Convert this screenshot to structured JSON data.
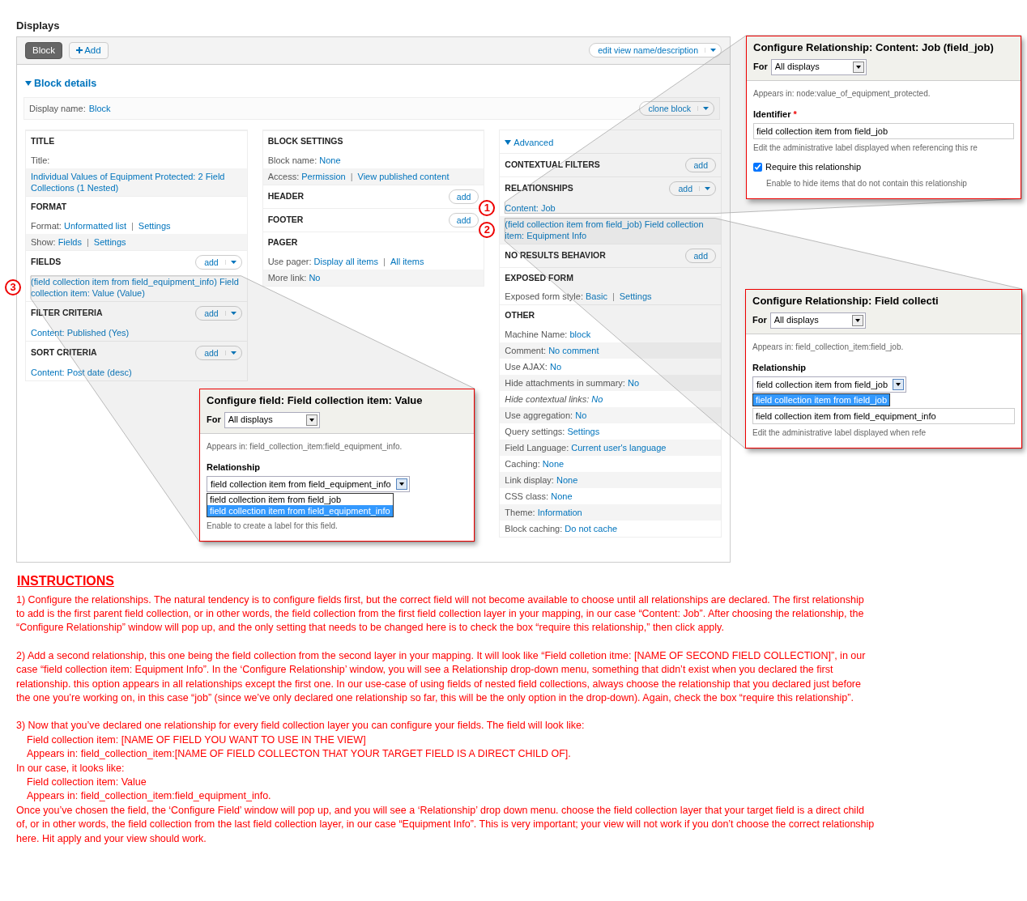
{
  "heading": "Displays",
  "display_tabs": [
    {
      "label": "Block",
      "kind": "display",
      "selected": true
    },
    {
      "label": "Add",
      "kind": "add",
      "selected": false
    }
  ],
  "edit_button": {
    "label": "edit view name/description",
    "dropdown": true
  },
  "details": {
    "label": "Block details",
    "expanded": true
  },
  "display_name": {
    "label": "Display name:",
    "value": "Block"
  },
  "clone_button": {
    "label": "clone block",
    "dropdown": true
  },
  "columns": [
    {
      "sections": [
        {
          "title": "TITLE",
          "rows": [
            {
              "label": "Title:"
            },
            {
              "values": [
                "Individual Values of Equipment Protected: 2 Field Collections (1 Nested)"
              ]
            }
          ]
        },
        {
          "title": "FORMAT",
          "rows": [
            {
              "label": "Format:",
              "values": [
                "Unformatted list",
                "|",
                "Settings"
              ]
            },
            {
              "label": "Show:",
              "values": [
                "Fields",
                "|",
                "Settings"
              ]
            }
          ]
        },
        {
          "title": "FIELDS",
          "add": {
            "label": "add",
            "dropdown": true
          },
          "rows": [
            {
              "values": [
                "(field collection item from field_equipment_info) Field collection item: Value (Value)"
              ],
              "marker": "3"
            }
          ]
        },
        {
          "title": "FILTER CRITERIA",
          "add": {
            "label": "add",
            "dropdown": true
          },
          "rows": [
            {
              "values": [
                "Content: Published (Yes)"
              ]
            }
          ]
        },
        {
          "title": "SORT CRITERIA",
          "add": {
            "label": "add",
            "dropdown": true
          },
          "rows": [
            {
              "values": [
                "Content: Post date (desc)"
              ]
            }
          ]
        }
      ]
    },
    {
      "sections": [
        {
          "title": "BLOCK SETTINGS",
          "rows": [
            {
              "label": "Block name:",
              "values": [
                "None"
              ]
            },
            {
              "label": "Access:",
              "values": [
                "Permission",
                "|",
                "View published content"
              ]
            }
          ]
        },
        {
          "title": "HEADER",
          "add": {
            "label": "add",
            "dropdown": false
          }
        },
        {
          "title": "FOOTER",
          "add": {
            "label": "add",
            "dropdown": false
          }
        },
        {
          "title": "PAGER",
          "rows": [
            {
              "label": "Use pager:",
              "values": [
                "Display all items",
                "|",
                "All items"
              ]
            },
            {
              "label": "More link:",
              "values": [
                "No"
              ]
            }
          ]
        }
      ]
    },
    {
      "toggle": {
        "label": "Advanced",
        "expanded": true
      },
      "sections": [
        {
          "title": "CONTEXTUAL FILTERS",
          "add": {
            "label": "add",
            "dropdown": false
          }
        },
        {
          "title": "RELATIONSHIPS",
          "add": {
            "label": "add",
            "dropdown": true
          },
          "rows": [
            {
              "values": [
                "Content: Job"
              ],
              "marker": "1"
            },
            {
              "values": [
                "(field collection item from field_job) Field collection item: Equipment Info"
              ],
              "marker": "2"
            }
          ]
        },
        {
          "title": "NO RESULTS BEHAVIOR",
          "add": {
            "label": "add",
            "dropdown": false
          }
        },
        {
          "title": "EXPOSED FORM",
          "rows": [
            {
              "label": "Exposed form style:",
              "values": [
                "Basic",
                "|",
                "Settings"
              ]
            }
          ]
        },
        {
          "title": "OTHER",
          "rows": [
            {
              "label": "Machine Name:",
              "values": [
                "block"
              ],
              "italic": false
            },
            {
              "label": "Comment:",
              "values": [
                "No comment"
              ],
              "italic": false
            },
            {
              "label": "Use AJAX:",
              "values": [
                "No"
              ],
              "italic": false
            },
            {
              "label": "Hide attachments in summary:",
              "values": [
                "No"
              ],
              "italic": false
            },
            {
              "label": "Hide contextual links:",
              "values": [
                "No"
              ],
              "italic": true
            },
            {
              "label": "Use aggregation:",
              "values": [
                "No"
              ],
              "italic": false
            },
            {
              "label": "Query settings:",
              "values": [
                "Settings"
              ],
              "italic": false
            },
            {
              "label": "Field Language:",
              "values": [
                "Current user's language"
              ],
              "italic": false
            },
            {
              "label": "Caching:",
              "values": [
                "None"
              ],
              "italic": false
            },
            {
              "label": "Link display:",
              "values": [
                "None"
              ],
              "italic": false
            },
            {
              "label": "CSS class:",
              "values": [
                "None"
              ],
              "italic": false
            },
            {
              "label": "Theme:",
              "values": [
                "Information"
              ],
              "italic": false
            },
            {
              "label": "Block caching:",
              "values": [
                "Do not cache"
              ],
              "italic": false
            }
          ]
        }
      ]
    }
  ],
  "popups": [
    {
      "title": "Configure Relationship: Content: Job (field_job)",
      "for_label": "For",
      "for_value": "All displays",
      "body": [
        {
          "kind": "note",
          "text": "Appears in: node:value_of_equipment_protected."
        },
        {
          "kind": "label",
          "text": "Identifier",
          "required": "*"
        },
        {
          "kind": "input",
          "value": "field collection item from field_job"
        },
        {
          "kind": "hint",
          "text": "Edit the administrative label displayed when referencing this re"
        },
        {
          "kind": "checkbox",
          "label": "Require this relationship",
          "checked": true,
          "hint": "Enable to hide items that do not contain this relationship"
        }
      ]
    },
    {
      "title": "Configure Relationship: Field collecti",
      "for_label": "For",
      "for_value": "All displays",
      "body": [
        {
          "kind": "note",
          "text": "Appears in: field_collection_item:field_job."
        },
        {
          "kind": "label",
          "text": "Relationship"
        },
        {
          "kind": "select",
          "value": "field collection item from field_job",
          "options": [
            {
              "text": "field collection item from field_job",
              "selected": true
            }
          ]
        },
        {
          "kind": "input",
          "value": "field collection item from field_equipment_info"
        },
        {
          "kind": "hint",
          "text": "Edit the administrative label displayed when refe"
        }
      ]
    },
    {
      "title": "Configure field: Field collection item: Value",
      "for_label": "For",
      "for_value": "All displays",
      "body": [
        {
          "kind": "note",
          "text": "Appears in: field_collection_item:field_equipment_info."
        },
        {
          "kind": "label",
          "text": "Relationship"
        },
        {
          "kind": "select",
          "value": "field collection item from field_equipment_info",
          "options": [
            {
              "text": "field collection item from field_job",
              "selected": false
            },
            {
              "text": "field collection item from field_equipment_info",
              "selected": true
            }
          ]
        },
        {
          "kind": "hint",
          "text": "Enable to create a label for this field."
        }
      ]
    }
  ],
  "instructions": {
    "heading": "INSTRUCTIONS",
    "paragraphs": [
      {
        "lines": [
          {
            "text": "1) Configure the relationships. The natural tendency is to configure fields first, but the correct field will not become available to choose until all relationships are declared. The first relationship to add is the first parent field collection, or in other words, the field collection from the first field collection layer in your mapping, in our case “Content: Job”. After choosing the relationship, the “Configure Relationship” window will pop up, and the only setting that needs to be changed here is to check the box “require this relationship,” then click apply.",
            "indent": false
          }
        ]
      },
      {
        "lines": [
          {
            "text": "2) Add a second relationship, this one being the field collection from the second layer in your mapping. It will look like “Field colletion itme: [NAME OF SECOND FIELD COLLECTION]”, in our case “field collection item: Equipment Info”. In the ‘Configure Relationship’ window, you will see a Relationship drop-down menu, something that didn’t exist when you declared the first relationship. this option appears in all relationships except the first one. In our use-case of using fields of nested field collections, always choose the relationship that you declared just before the one you’re working on, in this case “job” (since we’ve only declared one relationship so far, this will be the only option in the drop-down). Again, check the box “require this relationship”.",
            "indent": false
          }
        ]
      },
      {
        "lines": [
          {
            "text": "3) Now that you’ve declared one relationship for every field collection layer you can configure your fields. The field will look like:",
            "indent": false
          },
          {
            "text": "Field collection item: [NAME OF FIELD YOU WANT TO USE IN THE VIEW]",
            "indent": true
          },
          {
            "text": "Appears in: field_collection_item:[NAME OF FIELD COLLECTON THAT YOUR TARGET FIELD IS A DIRECT CHILD OF].",
            "indent": true
          },
          {
            "text": "In our case, it looks like:",
            "indent": false
          },
          {
            "text": "Field collection item: Value",
            "indent": true
          },
          {
            "text": "Appears in: field_collection_item:field_equipment_info.",
            "indent": true
          },
          {
            "text": "Once you’ve chosen the field, the ‘Configure Field’ window will pop up, and you will see a ‘Relationship’ drop down menu. choose the field collection layer that your target field is a direct child of, or in other words, the field collection from the last field collection layer, in our case “Equipment Info”. This is very important; your view will not work if you don’t choose the correct relationship here. Hit apply and your view should work.",
            "indent": false
          }
        ]
      }
    ]
  }
}
